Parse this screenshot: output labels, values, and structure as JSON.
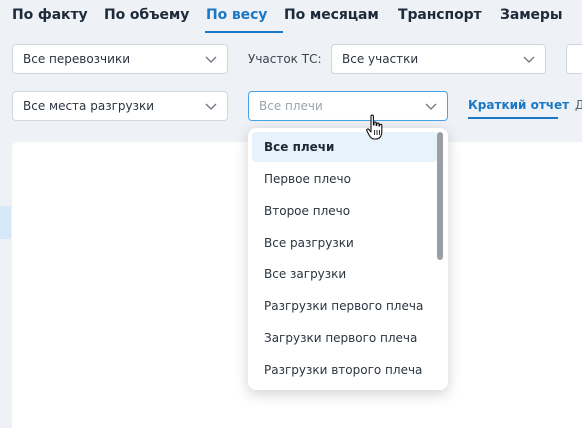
{
  "tabs": [
    {
      "label": "По факту"
    },
    {
      "label": "По объему"
    },
    {
      "label": "По весу"
    },
    {
      "label": "По месяцам"
    },
    {
      "label": "Транспорт"
    },
    {
      "label": "Замеры"
    }
  ],
  "filters": {
    "carrier": {
      "value": "Все перевозчики"
    },
    "section_label": "Участок ТС:",
    "section": {
      "value": "Все участки"
    },
    "unload_place": {
      "value": "Все места разгрузки"
    },
    "leg": {
      "placeholder": "Все плечи"
    }
  },
  "report_tabs": {
    "short_report": "Краткий отчет",
    "next_cut": "Д"
  },
  "leg_dropdown": {
    "options": [
      "Все плечи",
      "Первое плечо",
      "Второе плечо",
      "Все разгрузки",
      "Все загрузки",
      "Разгрузки первого плеча",
      "Загрузки первого плеча",
      "Разгрузки второго плеча"
    ],
    "selected_index": 0
  },
  "colors": {
    "accent": "#1b78c4",
    "selected_bg": "#e6f3fb",
    "page_bg": "#eef1f5"
  }
}
